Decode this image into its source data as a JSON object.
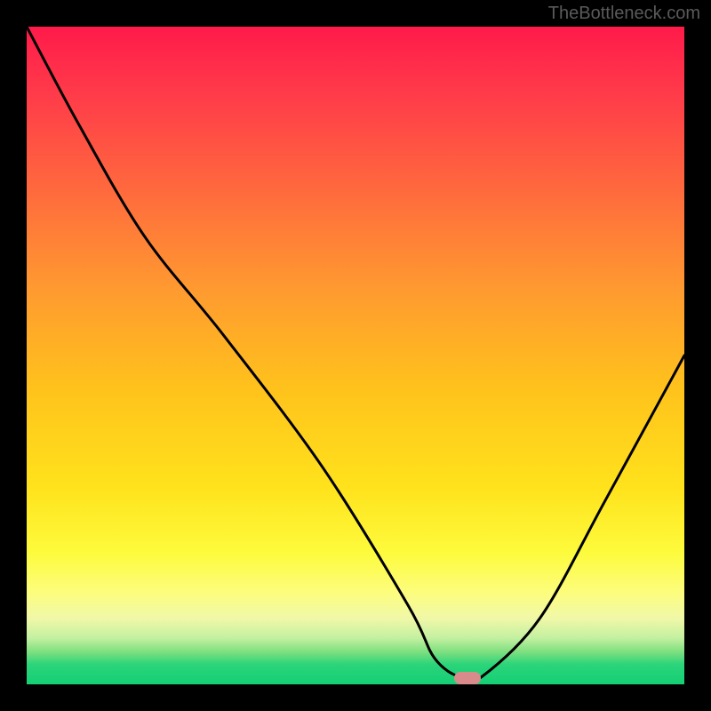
{
  "watermark": "TheBottleneck.com",
  "chart_data": {
    "type": "line",
    "title": "",
    "xlabel": "",
    "ylabel": "",
    "xlim": [
      0,
      100
    ],
    "ylim": [
      0,
      100
    ],
    "series": [
      {
        "name": "bottleneck-curve",
        "x": [
          0,
          8,
          18,
          30,
          45,
          58,
          62,
          66,
          69,
          78,
          88,
          100
        ],
        "y": [
          100,
          85,
          68,
          53,
          33,
          12,
          4,
          1,
          1,
          10,
          28,
          50
        ]
      }
    ],
    "marker": {
      "x": 67,
      "y": 1
    },
    "gradient_colors": {
      "top": "#ff1a4a",
      "mid": "#ffe21c",
      "bottom": "#15cf75"
    }
  }
}
